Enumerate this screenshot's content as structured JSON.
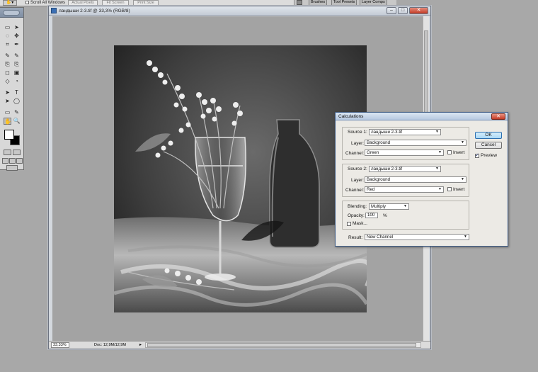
{
  "options_bar": {
    "scroll_all_windows_label": "Scroll All Windows",
    "actual_pixels_label": "Actual Pixels",
    "fit_screen_label": "Fit Screen",
    "print_size_label": "Print Size",
    "panel_tabs": [
      "Brushes",
      "Tool Presets",
      "Layer Comps"
    ]
  },
  "tools": {
    "items": [
      "▭",
      "➤",
      "◌",
      "✥",
      "⌗",
      "✒",
      "✎",
      "✎",
      "⎘",
      "⎘",
      "◻",
      "▣",
      "◇",
      "◔",
      "➤",
      "T",
      "➤",
      "◯",
      "▭",
      "✎",
      "✋",
      "🔍"
    ]
  },
  "document": {
    "title": "ландыши 2-3.tif @ 33,3% (RGB/8)",
    "zoom": "33,33%",
    "doc_size": "Doc: 12,9M/12,9M",
    "status_arrow": "▸"
  },
  "dialog": {
    "title": "Calculations",
    "close_glyph": "✕",
    "source1": {
      "label": "Source 1:",
      "file": "ландыши 2-3.tif",
      "layer_label": "Layer:",
      "layer": "Background",
      "channel_label": "Channel:",
      "channel": "Green",
      "invert_label": "Invert",
      "invert_checked": false
    },
    "source2": {
      "label": "Source 2:",
      "file": "ландыши 2-3.tif",
      "layer_label": "Layer:",
      "layer": "Background",
      "channel_label": "Channel:",
      "channel": "Red",
      "invert_label": "Invert",
      "invert_checked": false
    },
    "blending": {
      "label": "Blending:",
      "mode": "Multiply",
      "opacity_label": "Opacity:",
      "opacity": "100",
      "percent": "%",
      "mask_label": "Mask...",
      "mask_checked": false
    },
    "result": {
      "label": "Result:",
      "value": "New Channel"
    },
    "ok_label": "OK",
    "cancel_label": "Cancel",
    "preview_label": "Preview",
    "preview_checked": true
  },
  "colors": {
    "workspace": "#a8a8a8",
    "dialog_bg": "#eceae5",
    "title_blue": "#b6c8e0",
    "close_red": "#c63c26"
  }
}
